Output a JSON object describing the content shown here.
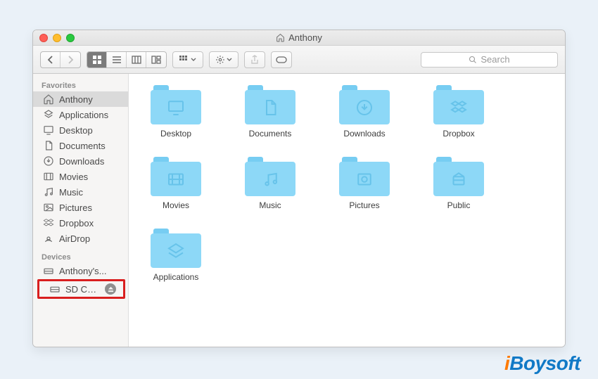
{
  "window": {
    "title": "Anthony"
  },
  "toolbar": {
    "search_placeholder": "Search"
  },
  "sidebar": {
    "favorites_label": "Favorites",
    "favorites": [
      {
        "label": "Anthony",
        "icon": "home-icon",
        "selected": true
      },
      {
        "label": "Applications",
        "icon": "apps-icon",
        "selected": false
      },
      {
        "label": "Desktop",
        "icon": "desktop-icon",
        "selected": false
      },
      {
        "label": "Documents",
        "icon": "doc-icon",
        "selected": false
      },
      {
        "label": "Downloads",
        "icon": "download-icon",
        "selected": false
      },
      {
        "label": "Movies",
        "icon": "movies-icon",
        "selected": false
      },
      {
        "label": "Music",
        "icon": "music-icon",
        "selected": false
      },
      {
        "label": "Pictures",
        "icon": "pictures-icon",
        "selected": false
      },
      {
        "label": "Dropbox",
        "icon": "dropbox-icon",
        "selected": false
      },
      {
        "label": "AirDrop",
        "icon": "airdrop-icon",
        "selected": false
      }
    ],
    "devices_label": "Devices",
    "devices": [
      {
        "label": "Anthony's...",
        "icon": "drive-icon",
        "ejectable": false,
        "highlighted": false
      },
      {
        "label": "SD Card",
        "icon": "drive-icon",
        "ejectable": true,
        "highlighted": true
      }
    ]
  },
  "folders": [
    {
      "label": "Desktop",
      "glyph": "desktop"
    },
    {
      "label": "Documents",
      "glyph": "doc"
    },
    {
      "label": "Downloads",
      "glyph": "download"
    },
    {
      "label": "Dropbox",
      "glyph": "dropbox"
    },
    {
      "label": "Movies",
      "glyph": "movies"
    },
    {
      "label": "Music",
      "glyph": "music"
    },
    {
      "label": "Pictures",
      "glyph": "pictures"
    },
    {
      "label": "Public",
      "glyph": "public"
    },
    {
      "label": "Applications",
      "glyph": "apps"
    }
  ],
  "watermark": "iBoysoft"
}
